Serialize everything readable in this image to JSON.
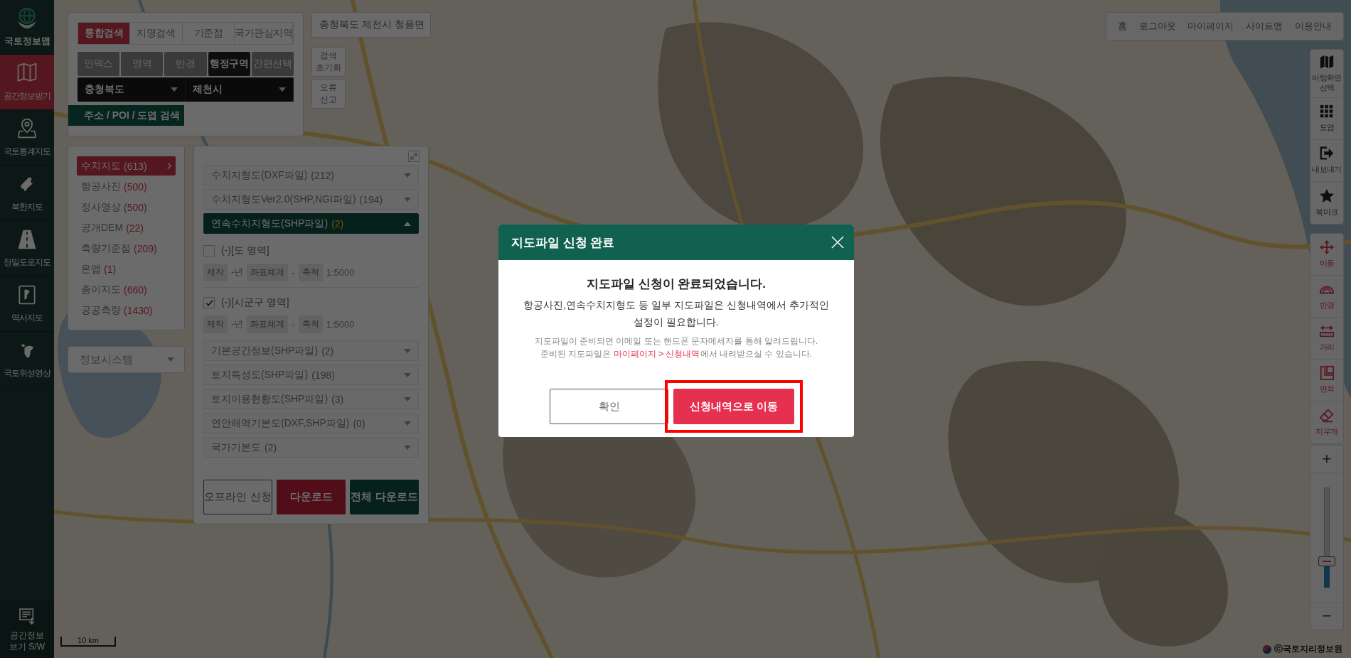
{
  "sidebar": {
    "logo": "국토정보맵",
    "items": [
      {
        "label": "공간정보받기",
        "selected": true
      },
      {
        "label": "국토통계지도",
        "selected": false
      },
      {
        "label": "북한지도",
        "selected": false
      },
      {
        "label": "정밀도로지도",
        "selected": false
      },
      {
        "label": "역사지도",
        "selected": false
      },
      {
        "label": "국토위성영상",
        "selected": false
      }
    ],
    "footer": "공간정보 보기 S/W"
  },
  "search_panel": {
    "tabs": [
      {
        "label": "통합검색",
        "selected": true
      },
      {
        "label": "지명검색",
        "selected": false
      },
      {
        "label": "기준점",
        "selected": false
      },
      {
        "label": "국가관심지역",
        "selected": false
      }
    ],
    "modes": [
      {
        "label": "인덱스",
        "selected": false
      },
      {
        "label": "영역",
        "selected": false
      },
      {
        "label": "반경",
        "selected": false
      },
      {
        "label": "행정구역",
        "selected": true
      },
      {
        "label": "간편선택",
        "selected": false
      }
    ],
    "selects": [
      "충청북도",
      "제천시"
    ],
    "address_button": "주소 / POI / 도엽 검색"
  },
  "location": "충청북도 제천시 청풍면",
  "map_buttons": [
    "검색 초기화",
    "오류 신고"
  ],
  "categories": [
    {
      "name": "수치지도",
      "count": "(613)",
      "selected": true
    },
    {
      "name": "항공사진",
      "count": "(500)",
      "selected": false
    },
    {
      "name": "정사영상",
      "count": "(500)",
      "selected": false
    },
    {
      "name": "공개DEM",
      "count": "(22)",
      "selected": false
    },
    {
      "name": "측량기준점",
      "count": "(209)",
      "selected": false
    },
    {
      "name": "온맵",
      "count": "(1)",
      "selected": false
    },
    {
      "name": "종이지도",
      "count": "(660)",
      "selected": false
    },
    {
      "name": "공공측량",
      "count": "(1430)",
      "selected": false
    }
  ],
  "system_select": "정보시스템",
  "detail": {
    "sections": [
      {
        "title": "수치지형도(DXF파일)",
        "count": "(212)",
        "expanded": false
      },
      {
        "title": "수치지형도Ver2.0(SHP,NGI파일)",
        "count": "(194)",
        "expanded": false
      },
      {
        "title": "연속수치지형도(SHP파일)",
        "count": "(2)",
        "expanded": true,
        "items": [
          {
            "label": "(-)[도 영역]",
            "checked": false,
            "meta": [
              {
                "tag": "제작",
                "value": "-년"
              },
              {
                "tag": "좌표체계",
                "value": "-"
              },
              {
                "tag": "축척",
                "value": "1:5000"
              }
            ]
          },
          {
            "label": "(-)[시군구 영역]",
            "checked": true,
            "meta": [
              {
                "tag": "제작",
                "value": "-년"
              },
              {
                "tag": "좌표체계",
                "value": "-"
              },
              {
                "tag": "축척",
                "value": "1:5000"
              }
            ]
          }
        ]
      },
      {
        "title": "기본공간정보(SHP파일)",
        "count": "(2)",
        "expanded": false
      },
      {
        "title": "토지특성도(SHP파일)",
        "count": "(198)",
        "expanded": false
      },
      {
        "title": "토지이용현황도(SHP파일)",
        "count": "(3)",
        "expanded": false
      },
      {
        "title": "연안해역기본도(DXF,SHP파일)",
        "count": "(0)",
        "expanded": false
      },
      {
        "title": "국가기본도",
        "count": "(2)",
        "expanded": false
      }
    ],
    "buttons": [
      {
        "label": "오프라인 신청",
        "kind": "outline"
      },
      {
        "label": "다운로드",
        "kind": "primary"
      },
      {
        "label": "전체 다운로드",
        "kind": "secondary"
      }
    ]
  },
  "top_nav": [
    "홈",
    "로그아웃",
    "마이페이지",
    "사이트맵",
    "이용안내"
  ],
  "tool_groups": [
    {
      "kind": "view",
      "items": [
        "바탕화면 선택",
        "도엽",
        "내보내기",
        "북마크"
      ]
    },
    {
      "kind": "draw",
      "items": [
        "이동",
        "반경",
        "거리",
        "면적",
        "지우개"
      ]
    }
  ],
  "zoom": {
    "zoom_in": "+",
    "zoom_out": "−",
    "level": 0.26
  },
  "scale_bar": "10 km",
  "copyright": "ⓒ국토지리정보원",
  "modal": {
    "title": "지도파일 신청 완료",
    "heading": "지도파일 신청이 완료되었습니다.",
    "message": "항공사진,연속수치지형도 등 일부 지도파일은 신청내역에서 추가적인 설정이 필요합니다.",
    "notes": [
      [
        {
          "text": "지도파일이 준비되면 이메일 또는 핸드폰 문자메세지를 통해 알려드립니다."
        }
      ],
      [
        {
          "text": "준비된 지도파일은 "
        },
        {
          "text": "마이페이지 > 신청내역",
          "kind": "link"
        },
        {
          "text": "에서 내려받으실 수 있습니다."
        }
      ]
    ],
    "buttons": [
      {
        "label": "확인",
        "kind": "outline",
        "highlighted": false
      },
      {
        "label": "신청내역으로 이동",
        "kind": "primary",
        "highlighted": true
      }
    ]
  }
}
